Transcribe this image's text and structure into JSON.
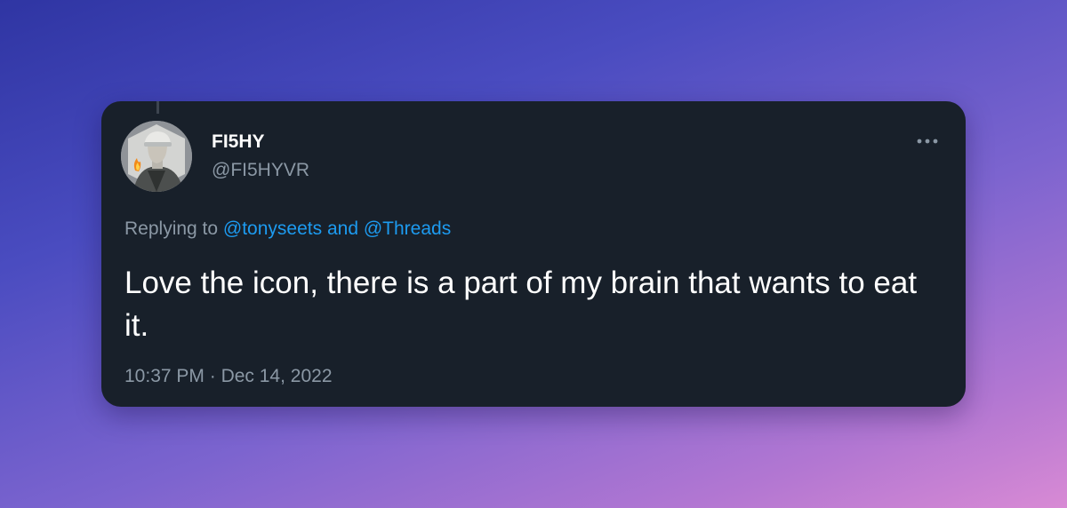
{
  "tweet": {
    "display_name": "FI5HY",
    "handle": "@FI5HYVR",
    "replying_prefix": "Replying to",
    "reply_targets": [
      "@tonyseets",
      "@Threads"
    ],
    "reply_conjunction": "and",
    "text": "Love the icon, there is a part of my brain that wants to eat it.",
    "time": "10:37 PM",
    "separator": "·",
    "date": "Dec 14, 2022"
  },
  "icons": {
    "more": "more-horizontal-icon",
    "avatar": "profile-avatar"
  },
  "colors": {
    "card_bg": "#18202a",
    "link": "#1d9bf0",
    "muted": "#8b98a5",
    "text": "#ffffff"
  }
}
